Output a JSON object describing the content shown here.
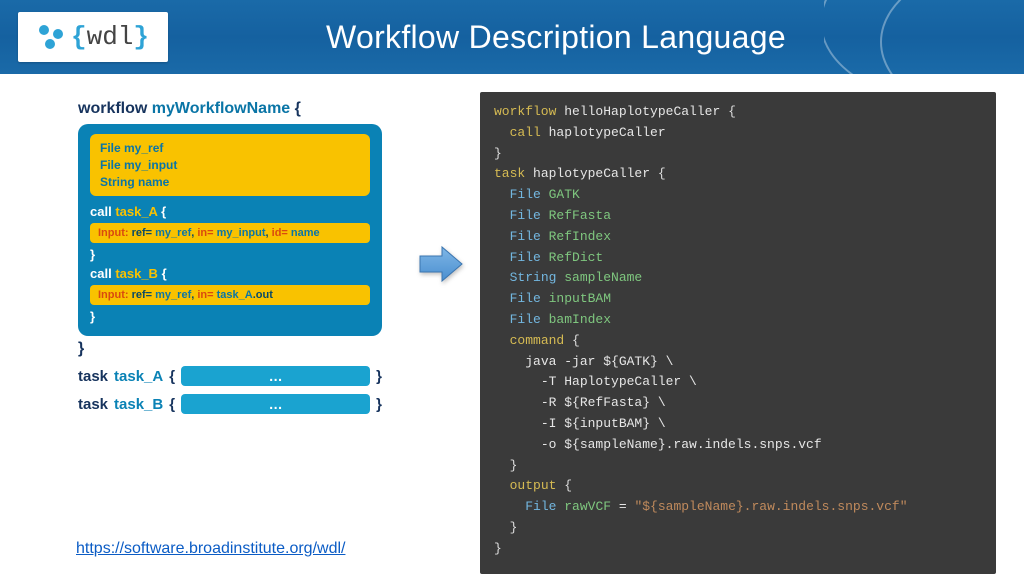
{
  "header": {
    "logo_text": "wdl",
    "title": "Workflow Description Language"
  },
  "pseudo": {
    "workflow_label": "workflow",
    "workflow_name": "myWorkflowName",
    "open_brace": "{",
    "close_brace": "}",
    "top_box_lines": [
      "File my_ref",
      "File my_input",
      "String name"
    ],
    "call_label": "call",
    "task_a_name": "task_A",
    "task_b_name": "task_B",
    "input_a_html": "<span class='kw'>Input:</span> ref= <span class='vl'>my_ref</span>, <span class='kw'>in=</span> <span class='vl'>my_input</span>, <span class='kw'>id=</span> <span class='vl'>name</span>",
    "input_b_html": "<span class='kw'>Input:</span> ref= <span class='vl'>my_ref</span>, <span class='kw'>in=</span> <span class='vl'>task_A</span>.out",
    "task_label": "task",
    "pill_text": "…"
  },
  "code": {
    "lines": [
      [
        [
          "kw",
          "workflow"
        ],
        [
          "id",
          " helloHaplotypeCaller "
        ],
        [
          "br",
          "{"
        ]
      ],
      [
        [
          "sp",
          "  "
        ],
        [
          "kw",
          "call"
        ],
        [
          "id",
          " haplotypeCaller"
        ]
      ],
      [
        [
          "br",
          "}"
        ]
      ],
      [
        [
          "kw",
          "task"
        ],
        [
          "id",
          " haplotypeCaller "
        ],
        [
          "br",
          "{"
        ]
      ],
      [
        [
          "sp",
          "  "
        ],
        [
          "tp",
          "File"
        ],
        [
          "var",
          " GATK"
        ]
      ],
      [
        [
          "sp",
          "  "
        ],
        [
          "tp",
          "File"
        ],
        [
          "var",
          " RefFasta"
        ]
      ],
      [
        [
          "sp",
          "  "
        ],
        [
          "tp",
          "File"
        ],
        [
          "var",
          " RefIndex"
        ]
      ],
      [
        [
          "sp",
          "  "
        ],
        [
          "tp",
          "File"
        ],
        [
          "var",
          " RefDict"
        ]
      ],
      [
        [
          "sp",
          "  "
        ],
        [
          "tp",
          "String"
        ],
        [
          "var",
          " sampleName"
        ]
      ],
      [
        [
          "sp",
          "  "
        ],
        [
          "tp",
          "File"
        ],
        [
          "var",
          " inputBAM"
        ]
      ],
      [
        [
          "sp",
          "  "
        ],
        [
          "tp",
          "File"
        ],
        [
          "var",
          " bamIndex"
        ]
      ],
      [
        [
          "sp",
          "  "
        ],
        [
          "kw",
          "command"
        ],
        [
          "id",
          " "
        ],
        [
          "br",
          "{"
        ]
      ],
      [
        [
          "sp",
          "    "
        ],
        [
          "id",
          "java -jar ${GATK} \\\\"
        ]
      ],
      [
        [
          "sp",
          "      "
        ],
        [
          "id",
          "-T HaplotypeCaller \\\\"
        ]
      ],
      [
        [
          "sp",
          "      "
        ],
        [
          "id",
          "-R ${RefFasta} \\\\"
        ]
      ],
      [
        [
          "sp",
          "      "
        ],
        [
          "id",
          "-I ${inputBAM} \\\\"
        ]
      ],
      [
        [
          "sp",
          "      "
        ],
        [
          "id",
          "-o ${sampleName}.raw.indels.snps.vcf"
        ]
      ],
      [
        [
          "sp",
          "  "
        ],
        [
          "br",
          "}"
        ]
      ],
      [
        [
          "sp",
          "  "
        ],
        [
          "kw",
          "output"
        ],
        [
          "id",
          " "
        ],
        [
          "br",
          "{"
        ]
      ],
      [
        [
          "sp",
          "    "
        ],
        [
          "tp",
          "File"
        ],
        [
          "var",
          " rawVCF"
        ],
        [
          "id",
          " = "
        ],
        [
          "str",
          "\"${sampleName}.raw.indels.snps.vcf\""
        ]
      ],
      [
        [
          "sp",
          "  "
        ],
        [
          "br",
          "}"
        ]
      ],
      [
        [
          "br",
          "}"
        ]
      ]
    ]
  },
  "footer": {
    "link_text": "https://software.broadinstitute.org/wdl/",
    "link_href": "https://software.broadinstitute.org/wdl/"
  }
}
